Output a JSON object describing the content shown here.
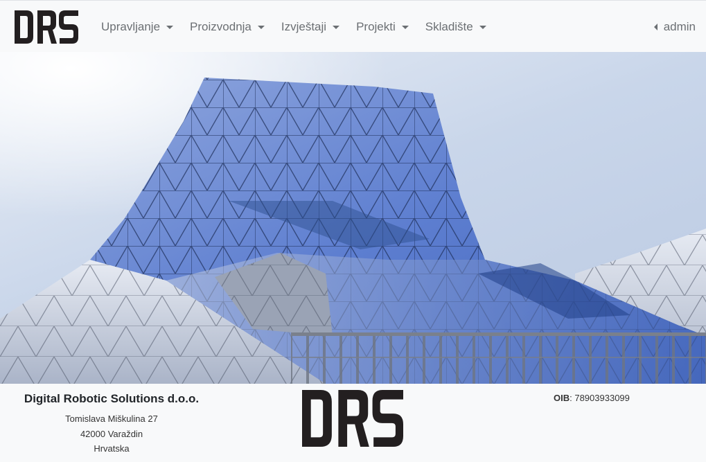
{
  "brand": {
    "logo_text": "DRS"
  },
  "nav": {
    "items": [
      {
        "label": "Upravljanje"
      },
      {
        "label": "Proizvodnja"
      },
      {
        "label": "Izvještaji"
      },
      {
        "label": "Projekti"
      },
      {
        "label": "Skladište"
      }
    ],
    "user": "admin"
  },
  "footer": {
    "company_name": "Digital Robotic Solutions d.o.o.",
    "address": [
      "Tomislava Miškulina 27",
      "42000 Varaždin",
      "Hrvatska"
    ],
    "oib_label": "OIB",
    "oib_value": ": 78903933099",
    "logo_text": "DRS"
  },
  "colors": {
    "nav_text": "#6b6f73",
    "background": "#f8f9fa",
    "logo": "#231f20"
  }
}
